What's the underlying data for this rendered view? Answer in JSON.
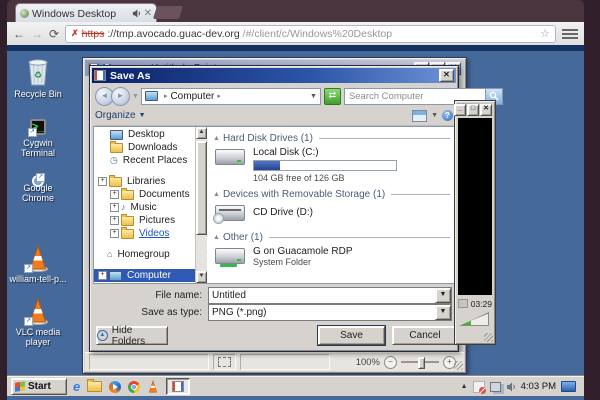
{
  "browser": {
    "tab_title": "Windows Desktop",
    "url_scheme_struck": "https",
    "url_host": "://tmp.avocado.guac-dev.org",
    "url_path": "/#/client/c/Windows%20Desktop"
  },
  "desktop": {
    "icons": [
      {
        "label": "Recycle Bin"
      },
      {
        "label": "Cygwin Terminal"
      },
      {
        "label": "Google Chrome"
      },
      {
        "label": "william-tell-p..."
      },
      {
        "label": "VLC media player"
      }
    ]
  },
  "paint": {
    "title": "Untitled - Paint",
    "zoom_level": "100%"
  },
  "dialog": {
    "title": "Save As",
    "breadcrumb_root": "Computer",
    "search_placeholder": "Search Computer",
    "organize_label": "Organize",
    "tree": [
      {
        "label": "Desktop"
      },
      {
        "label": "Downloads"
      },
      {
        "label": "Recent Places"
      },
      {
        "label": "Libraries"
      },
      {
        "label": "Documents"
      },
      {
        "label": "Music"
      },
      {
        "label": "Pictures"
      },
      {
        "label": "Videos"
      },
      {
        "label": "Homegroup"
      },
      {
        "label": "Computer"
      }
    ],
    "groups": [
      {
        "header": "Hard Disk Drives (1)",
        "drive_name": "Local Disk (C:)",
        "drive_detail": "104 GB free of 126 GB",
        "usage_percent": 18
      },
      {
        "header": "Devices with Removable Storage (1)",
        "drive_name": "CD Drive (D:)"
      },
      {
        "header": "Other (1)",
        "drive_name": "G on Guacamole RDP",
        "drive_detail": "System Folder"
      }
    ],
    "file_name_label": "File name:",
    "file_name_value": "Untitled",
    "save_type_label": "Save as type:",
    "save_type_value": "PNG (*.png)",
    "hide_folders_label": "Hide Folders",
    "save_label": "Save",
    "cancel_label": "Cancel"
  },
  "vlc": {
    "time": "03:29",
    "volume_percent": 38
  },
  "taskbar": {
    "start_label": "Start",
    "clock": "4:03 PM"
  }
}
